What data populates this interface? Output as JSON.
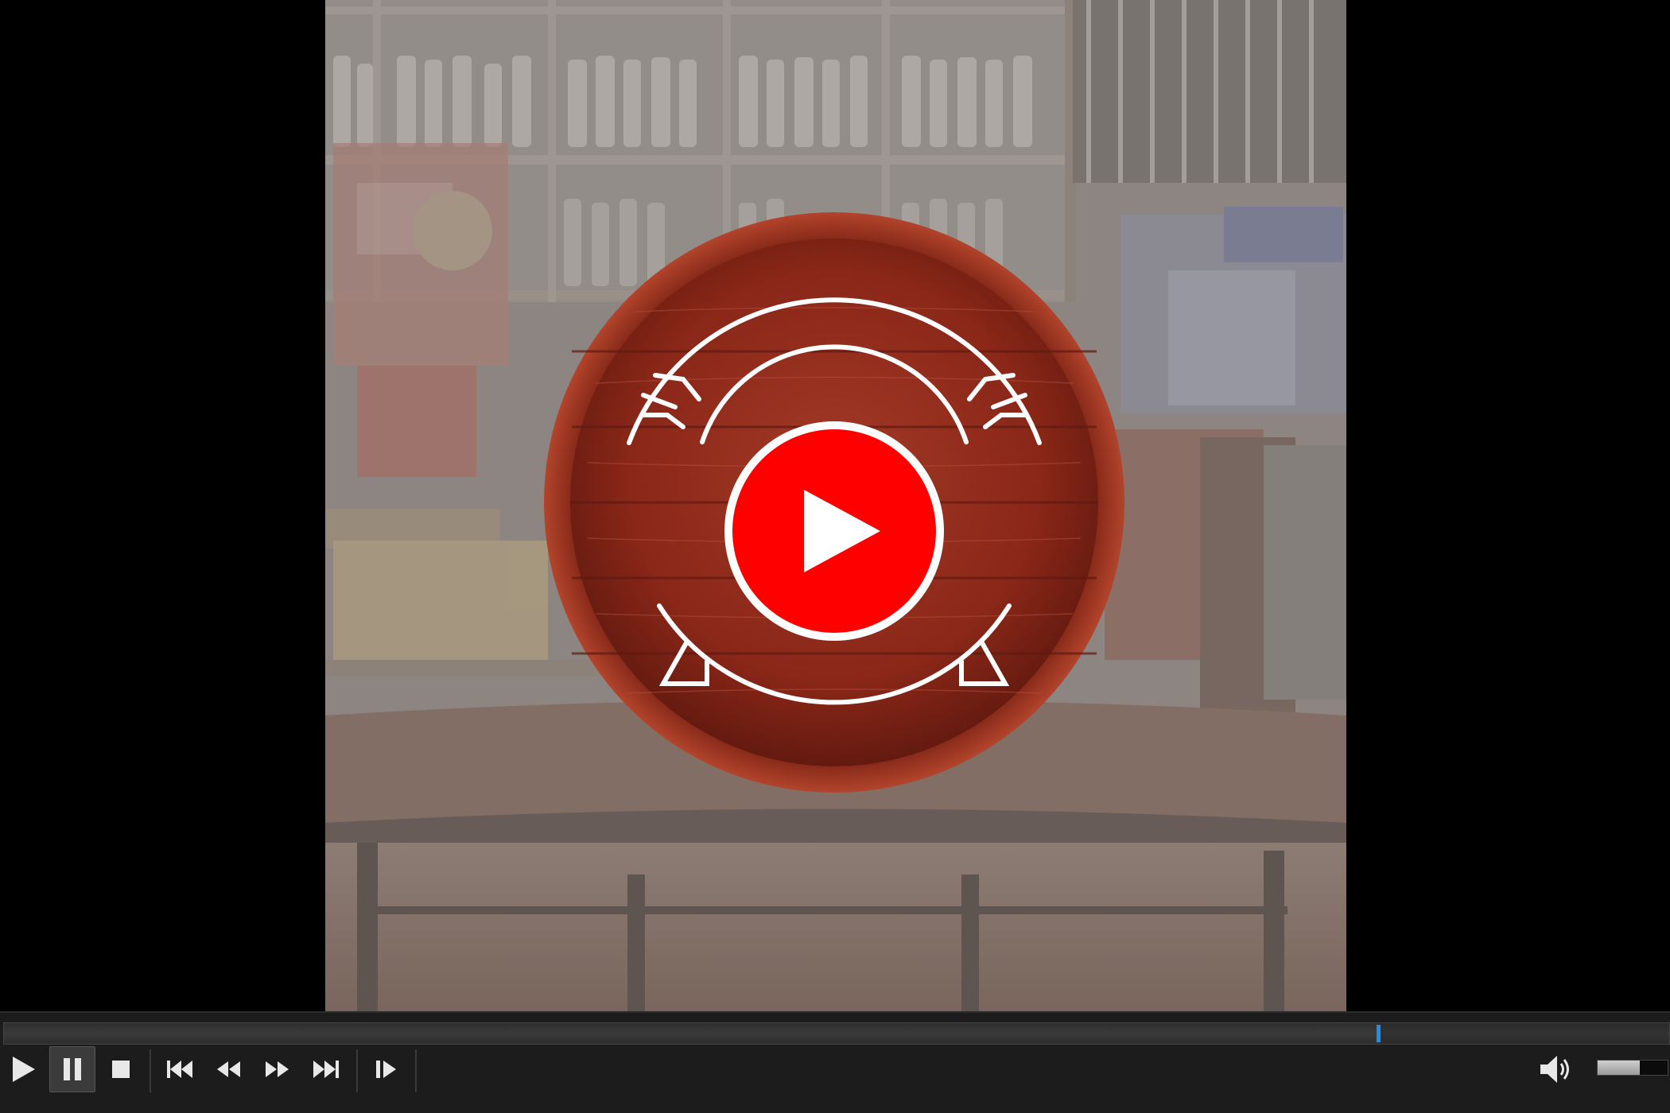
{
  "player": {
    "seek": {
      "progress_fraction": 0.825
    },
    "volume": {
      "level_fraction": 0.6
    },
    "buttons": [
      {
        "name": "play-button",
        "icon": "play-icon"
      },
      {
        "name": "pause-button",
        "icon": "pause-icon",
        "state": "active"
      },
      {
        "name": "stop-button",
        "icon": "stop-icon"
      },
      {
        "name": "previous-button",
        "icon": "skip-previous-icon"
      },
      {
        "name": "rewind-button",
        "icon": "rewind-icon"
      },
      {
        "name": "fast-forward-button",
        "icon": "fast-forward-icon"
      },
      {
        "name": "next-button",
        "icon": "skip-next-icon"
      },
      {
        "name": "frame-step-button",
        "icon": "frame-step-icon"
      },
      {
        "name": "volume-button",
        "icon": "speaker-icon"
      }
    ]
  },
  "video": {
    "logo": "wooden-barrel-youtube-play-logo",
    "colors": {
      "barrel_wood": "#8e2a1c",
      "play_red": "#ff0000",
      "seek_handle": "#1e8ef0"
    }
  }
}
